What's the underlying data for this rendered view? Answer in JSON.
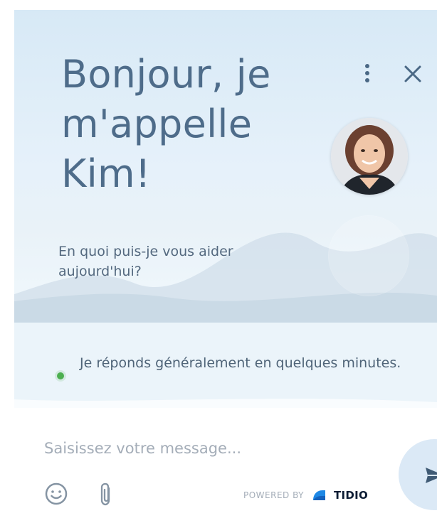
{
  "header": {
    "title": "Bonjour, je m'appelle Kim!",
    "subtitle": "En quoi puis-je vous aider aujourd'hui?",
    "status": "Je réponds généralement en quelques minutes."
  },
  "composer": {
    "placeholder": "Saisissez votre message...",
    "powered_by": "POWERED BY",
    "brand": "TIDIO"
  },
  "icons": {
    "more": "more-vertical-icon",
    "close": "close-icon",
    "emoji": "smiley-icon",
    "attach": "paperclip-icon",
    "send": "send-icon",
    "brand_logo": "tidio-logo-icon"
  },
  "colors": {
    "title": "#4e6c8a",
    "status_online": "#4caf50",
    "brand_blue": "#1e88e5",
    "brand_text": "#0b1b33"
  }
}
